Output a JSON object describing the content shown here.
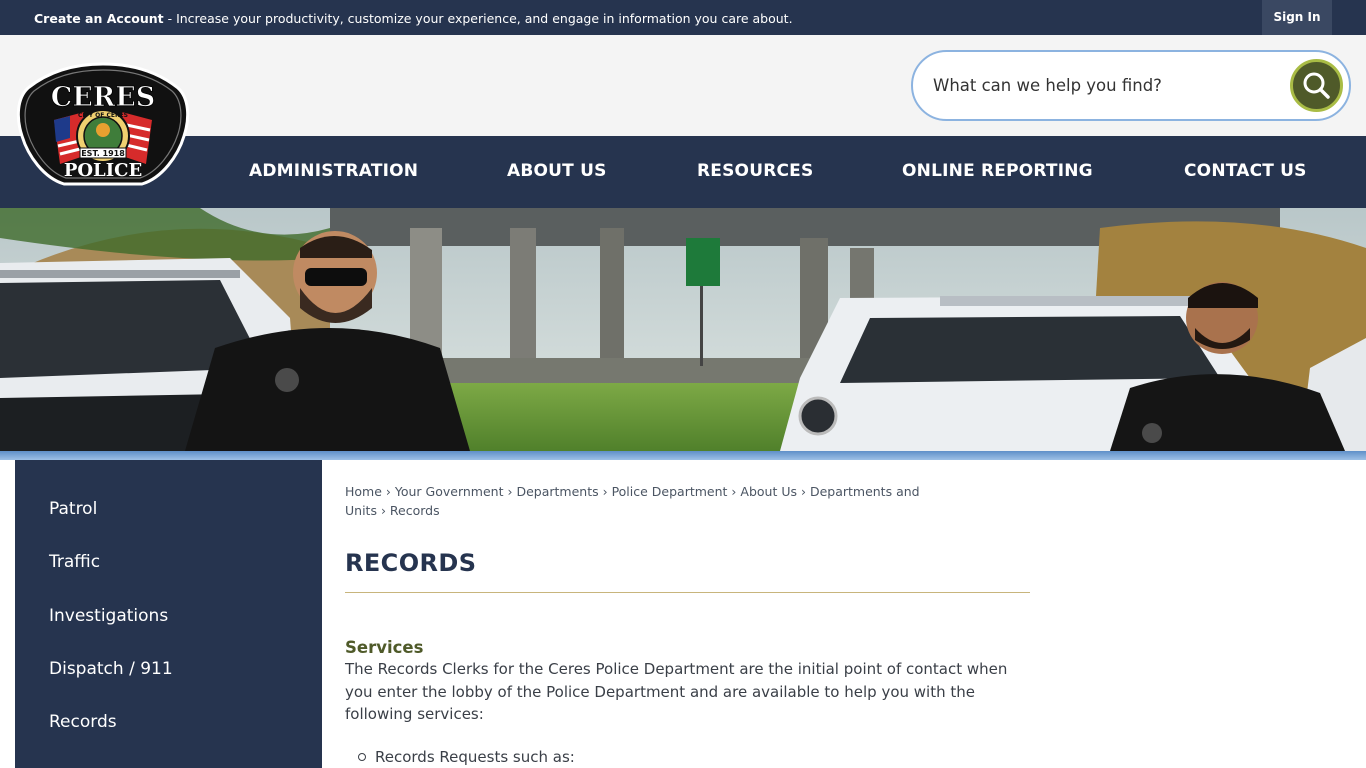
{
  "topbar": {
    "create_account": "Create an Account",
    "message": " - Increase your productivity, customize your experience, and engage in information you care about.",
    "sign_in": "Sign In"
  },
  "search": {
    "placeholder": "What can we help you find?"
  },
  "logo": {
    "top": "CERES",
    "ring": "CITY OF CERES",
    "est": "EST. 1918",
    "bottom": "POLICE"
  },
  "nav": [
    "ADMINISTRATION",
    "ABOUT US",
    "RESOURCES",
    "ONLINE REPORTING",
    "CONTACT US"
  ],
  "sidebar": [
    "Patrol",
    "Traffic",
    "Investigations",
    "Dispatch / 911",
    "Records"
  ],
  "breadcrumb": [
    "Home",
    "Your Government",
    "Departments",
    "Police Department",
    "About Us",
    "Departments and Units",
    "Records"
  ],
  "page": {
    "title": "RECORDS",
    "section_heading": "Services",
    "section_text": "The Records Clerks for the Ceres Police Department are the initial point of contact when you enter the lobby of the Police Department and are available to help you with the following services:",
    "list_item": "Records Requests such as:"
  },
  "colors": {
    "navy": "#26344f",
    "olive": "#4f5a29",
    "accent_line": "#c8b57c",
    "search_border": "#8cb3e0"
  }
}
